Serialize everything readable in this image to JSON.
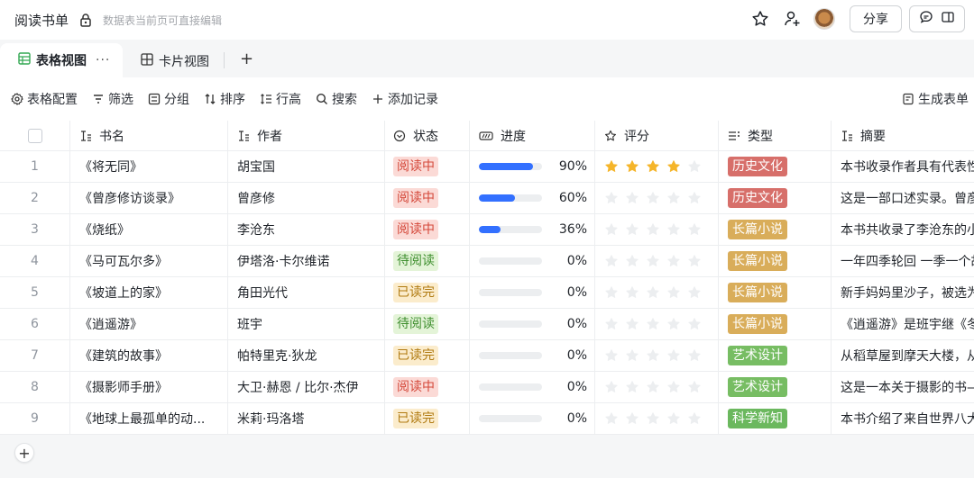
{
  "doc": {
    "title": "阅读书单",
    "hint": "数据表当前页可直接编辑"
  },
  "topbar": {
    "share_label": "分享"
  },
  "tabs": [
    {
      "label": "表格视图",
      "more": "···"
    },
    {
      "label": "卡片视图"
    }
  ],
  "tab_add": "+",
  "toolbar": {
    "items": [
      {
        "label": "表格配置",
        "icon": "gear-icon"
      },
      {
        "label": "筛选",
        "icon": "filter-icon"
      },
      {
        "label": "分组",
        "icon": "group-icon"
      },
      {
        "label": "排序",
        "icon": "sort-icon"
      },
      {
        "label": "行高",
        "icon": "row-height-icon"
      },
      {
        "label": "搜索",
        "icon": "search-icon"
      },
      {
        "label": "添加记录",
        "icon": "plus-icon"
      }
    ],
    "right_label": "生成表单"
  },
  "columns": [
    "书名",
    "作者",
    "状态",
    "进度",
    "评分",
    "类型",
    "摘要"
  ],
  "status_colors": {
    "阅读中": "st-reading",
    "待阅读": "st-todo",
    "已读完": "st-done"
  },
  "tag_colors": {
    "历史文化": "#d76f6a",
    "长篇小说": "#d9ad5a",
    "艺术设计": "#77bd63",
    "科学新知": "#6bb85e"
  },
  "rows": [
    {
      "num": "1",
      "book": "《将无同》",
      "author": "胡宝国",
      "status": "阅读中",
      "progress": 90,
      "progress_label": "90%",
      "rating": 4,
      "type": "历史文化",
      "summary": "本书收录作者具有代表性"
    },
    {
      "num": "2",
      "book": "《曾彦修访谈录》",
      "author": "曾彦修",
      "status": "阅读中",
      "progress": 60,
      "progress_label": "60%",
      "rating": 0,
      "type": "历史文化",
      "summary": "这是一部口述实录。曾彦"
    },
    {
      "num": "3",
      "book": "《烧纸》",
      "author": "李沧东",
      "status": "阅读中",
      "progress": 36,
      "progress_label": "36%",
      "rating": 0,
      "type": "长篇小说",
      "summary": "本书共收录了李沧东的小"
    },
    {
      "num": "4",
      "book": "《马可瓦尔多》",
      "author": "伊塔洛·卡尔维诺",
      "status": "待阅读",
      "progress": 0,
      "progress_label": "0%",
      "rating": 0,
      "type": "长篇小说",
      "summary": "一年四季轮回 一季一个故"
    },
    {
      "num": "5",
      "book": "《坡道上的家》",
      "author": "角田光代",
      "status": "已读完",
      "progress": 0,
      "progress_label": "0%",
      "rating": 0,
      "type": "长篇小说",
      "summary": "新手妈妈里沙子，被选为"
    },
    {
      "num": "6",
      "book": "《逍遥游》",
      "author": "班宇",
      "status": "待阅读",
      "progress": 0,
      "progress_label": "0%",
      "rating": 0,
      "type": "长篇小说",
      "summary": "《逍遥游》是班宇继《冬"
    },
    {
      "num": "7",
      "book": "《建筑的故事》",
      "author": "帕特里克·狄龙",
      "status": "已读完",
      "progress": 0,
      "progress_label": "0%",
      "rating": 0,
      "type": "艺术设计",
      "summary": "从稻草屋到摩天大楼，从"
    },
    {
      "num": "8",
      "book": "《摄影师手册》",
      "author": "大卫·赫恩 / 比尔·杰伊",
      "status": "阅读中",
      "progress": 0,
      "progress_label": "0%",
      "rating": 0,
      "type": "艺术设计",
      "summary": "这是一本关于摄影的书—"
    },
    {
      "num": "9",
      "book": "《地球上最孤单的动...",
      "author": "米莉·玛洛塔",
      "status": "已读完",
      "progress": 0,
      "progress_label": "0%",
      "rating": 0,
      "type": "科学新知",
      "summary": "本书介绍了来自世界八大"
    }
  ],
  "add_row": "+"
}
